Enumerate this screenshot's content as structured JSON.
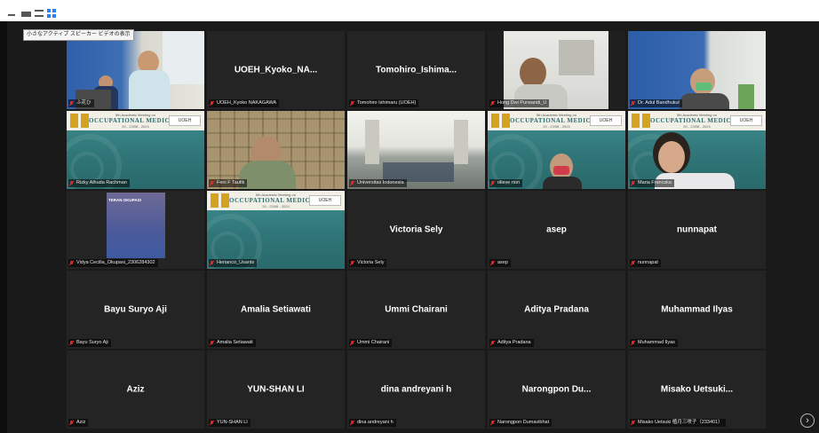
{
  "tooltip": "小さなアクティブ スピーカー ビデオの表示",
  "tiles": [
    {
      "name": "",
      "label": "ふ花ひ"
    },
    {
      "name": "UOEH_Kyoko_NA...",
      "label": "UOEH_Kyoko NAKAGAWA"
    },
    {
      "name": "Tomohiro_Ishima...",
      "label": "Tomohiro Ishimaru (UOEH)"
    },
    {
      "name": "",
      "label": "Hong Dwi Purwandi_U"
    },
    {
      "name": "",
      "label": "Dr. Adul Bandhukul"
    },
    {
      "name": "",
      "label": "Rizky Alhuda Rachman"
    },
    {
      "name": "",
      "label": "Feni F Taufik"
    },
    {
      "name": "",
      "label": "Universitas Indonesia"
    },
    {
      "name": "",
      "label": "olieve rion"
    },
    {
      "name": "",
      "label": "Maria Francska"
    },
    {
      "name": "",
      "label": "Vidya Cecilia_Okupasi_2306284302"
    },
    {
      "name": "",
      "label": "Herianco_Usants"
    },
    {
      "name": "Victoria Sely",
      "label": "Victoria Sely"
    },
    {
      "name": "asep",
      "label": "asep"
    },
    {
      "name": "nunnapat",
      "label": "nunnapat"
    },
    {
      "name": "Bayu Suryo Aji",
      "label": "Bayu Suryo Aji"
    },
    {
      "name": "Amalia Setiawati",
      "label": "Amalia Setiawati"
    },
    {
      "name": "Ummi Chairani",
      "label": "Ummi Chairani"
    },
    {
      "name": "Aditya Pradana",
      "label": "Aditya Pradana"
    },
    {
      "name": "Muhammad Ilyas",
      "label": "Muhammad Ilyas"
    },
    {
      "name": "Aziz",
      "label": "Aziz"
    },
    {
      "name": "YUN-SHAN LI",
      "label": "YUN-SHAN LI"
    },
    {
      "name": "dina andreyani h",
      "label": "dina andreyani h"
    },
    {
      "name": "Narongpon Du...",
      "label": "Narongpon Dumavibhat"
    },
    {
      "name": "Misako Uetsuki...",
      "label": "Misako Uetsuki 植月三咲子（233401）"
    }
  ],
  "slide": {
    "line1": "5th Academic Meeting on",
    "line2": "OCCUPATIONAL MEDICINE",
    "line3": "20 - 23/08 - 2024",
    "badge": "UOEH"
  },
  "teran_text": "TERAN OKUPASI",
  "next_icon": "›",
  "icons": {
    "mute": "mic-off-icon",
    "next": "chevron-right-icon"
  }
}
